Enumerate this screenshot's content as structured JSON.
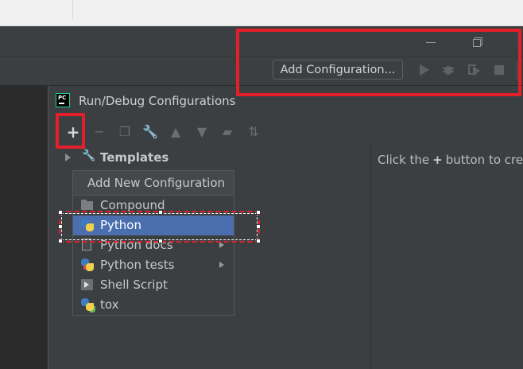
{
  "window": {
    "minimize_icon": "minimize-icon",
    "restore_icon": "restore-icon"
  },
  "toolbar": {
    "add_configuration_label": "Add Configuration...",
    "icons": [
      "run-icon",
      "debug-icon",
      "run-with-coverage-icon",
      "stop-icon"
    ]
  },
  "dialog": {
    "title": "Run/Debug Configurations",
    "toolbar_icons": [
      "add-icon",
      "remove-icon",
      "copy-icon",
      "wrench-icon",
      "move-up-icon",
      "move-down-icon",
      "folder-icon",
      "sort-icon"
    ],
    "add_button_glyph": "+",
    "tree": {
      "templates_label": "Templates"
    },
    "hint": {
      "prefix": "Click the",
      "plus_glyph": "+",
      "suffix": "button to cre"
    }
  },
  "popup": {
    "header": "Add New Configuration",
    "items": [
      {
        "label": "Compound",
        "icon": "folder-icon",
        "submenu": false,
        "selected": false
      },
      {
        "label": "Python",
        "icon": "python-icon",
        "submenu": false,
        "selected": true
      },
      {
        "label": "Python docs",
        "icon": "document-icon",
        "submenu": true,
        "selected": false
      },
      {
        "label": "Python tests",
        "icon": "python-tests-icon",
        "submenu": true,
        "selected": false
      },
      {
        "label": "Shell Script",
        "icon": "terminal-icon",
        "submenu": false,
        "selected": false
      },
      {
        "label": "tox",
        "icon": "tox-icon",
        "submenu": false,
        "selected": false
      }
    ]
  },
  "colors": {
    "annotation_red": "#e3202a",
    "selection_blue": "#4b6eaf",
    "dialog_bg": "#3c3f41"
  }
}
